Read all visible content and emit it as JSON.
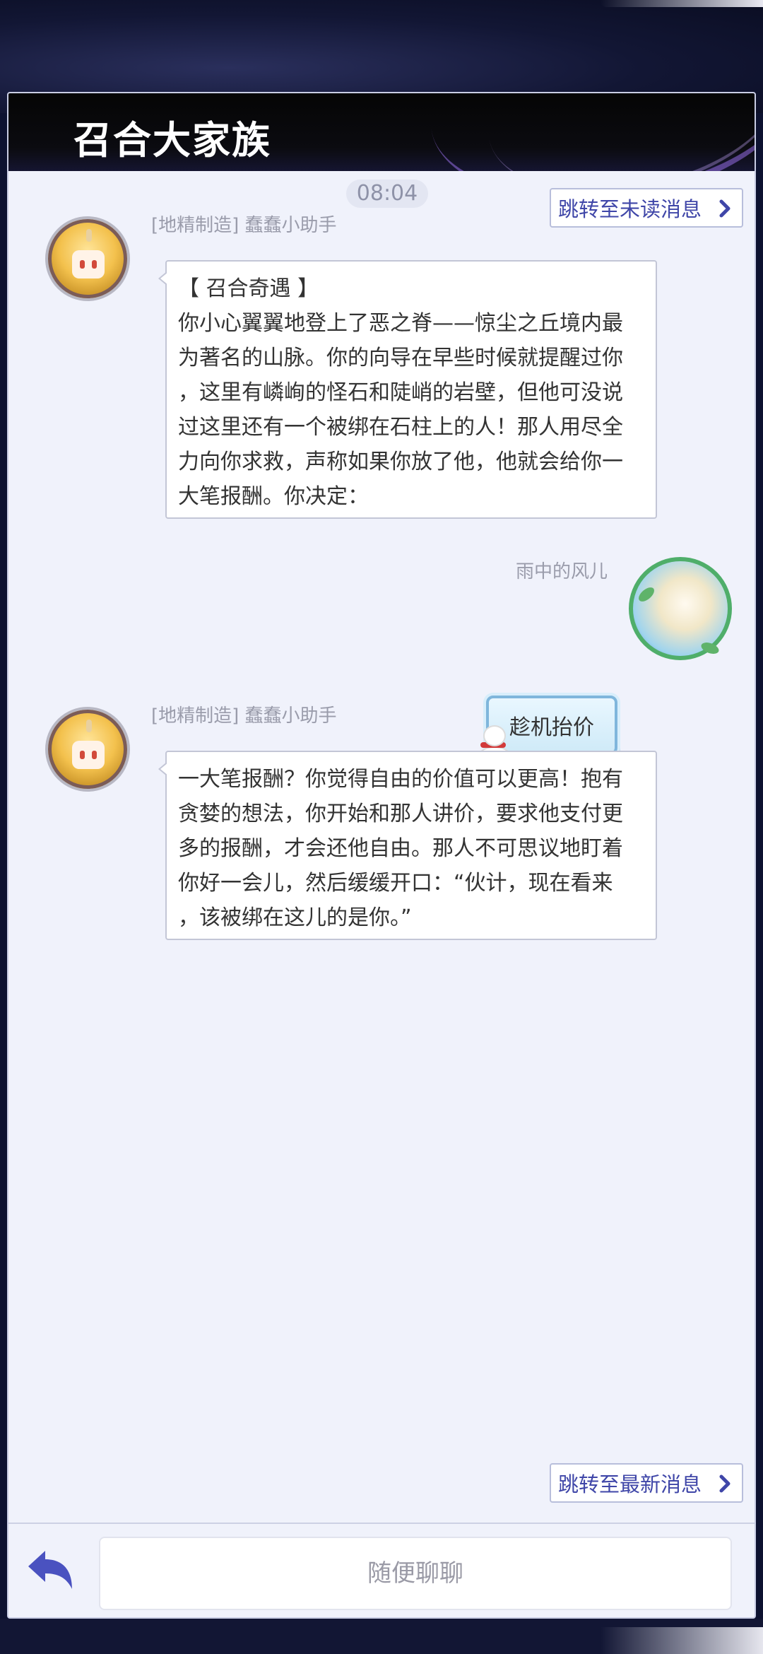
{
  "header": {
    "title": "召合大家族"
  },
  "chat": {
    "time": "08:04",
    "jump_unread": "跳转至未读消息",
    "jump_latest": "跳转至最新消息",
    "messages": [
      {
        "sender": "[地精制造] 蠢蠢小助手",
        "lines": [
          "【 召合奇遇 】",
          "你小心翼翼地登上了恶之脊——惊尘之丘境内最",
          "为著名的山脉。你的向导在早些时候就提醒过你",
          "，这里有嶙峋的怪石和陡峭的岩壁，但他可没说",
          "过这里还有一个被绑在石柱上的人！那人用尽全",
          "力向你求救，声称如果你放了他，他就会给你一",
          "大笔报酬。你决定："
        ]
      },
      {
        "sender": "雨中的风儿",
        "text": "趁机抬价"
      },
      {
        "sender": "[地精制造] 蠢蠢小助手",
        "lines": [
          "一大笔报酬？你觉得自由的价值可以更高！抱有",
          "贪婪的想法，你开始和那人讲价，要求他支付更",
          "多的报酬，才会还他自由。那人不可思议地盯着",
          "你好一会儿，然后缓缓开口：“伙计，现在看来",
          "，该被绑在这儿的是你。”"
        ]
      }
    ]
  },
  "input": {
    "placeholder": "随便聊聊"
  },
  "colors": {
    "accent": "#3f46a8",
    "panel_bg": "#f0f2fb",
    "header_bg": "#050505"
  },
  "icons": [
    "chevron-right-icon",
    "back-arrow-icon"
  ]
}
